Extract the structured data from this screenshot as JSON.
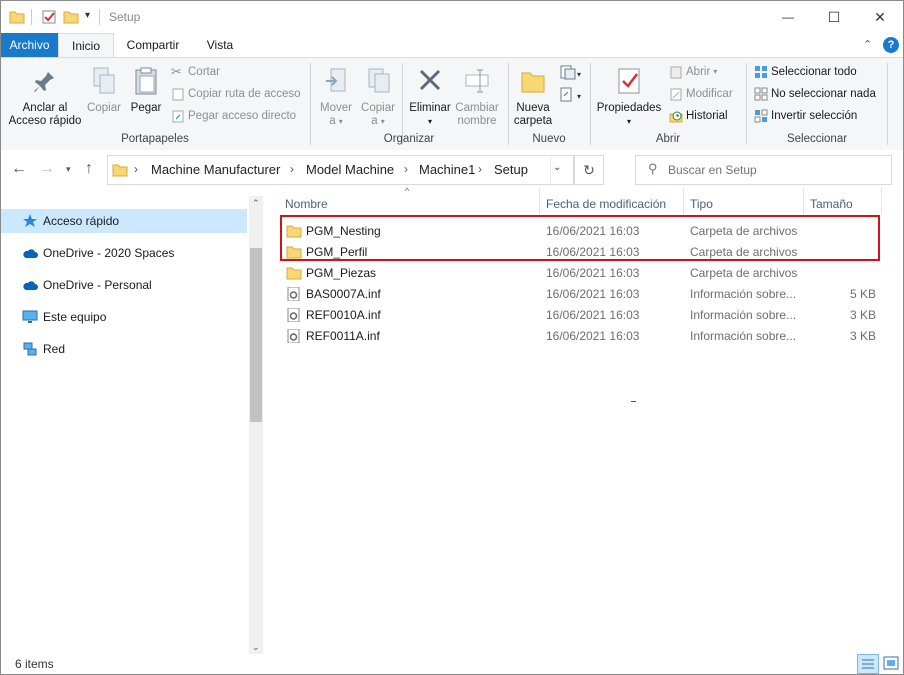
{
  "window": {
    "title": "Setup",
    "controls": {
      "minimize": "—",
      "maximize": "☐",
      "close": "✕"
    }
  },
  "ribbon_tabs": [
    {
      "label": "Archivo"
    },
    {
      "label": "Inicio"
    },
    {
      "label": "Compartir"
    },
    {
      "label": "Vista"
    }
  ],
  "ribbon": {
    "portapapeles": {
      "group_label": "Portapapeles",
      "pin_label_1": "Anclar al",
      "pin_label_2": "Acceso rápido",
      "copy_label": "Copiar",
      "paste_label": "Pegar",
      "cut_label": "Cortar",
      "copy_path_label": "Copiar ruta de acceso",
      "paste_shortcut_label": "Pegar acceso directo"
    },
    "organizar": {
      "group_label": "Organizar",
      "move_label_1": "Mover",
      "move_label_2": "a",
      "copyto_label_1": "Copiar",
      "copyto_label_2": "a",
      "delete_label": "Eliminar",
      "rename_label_1": "Cambiar",
      "rename_label_2": "nombre"
    },
    "nuevo": {
      "group_label": "Nuevo",
      "new_folder_label_1": "Nueva",
      "new_folder_label_2": "carpeta"
    },
    "abrir": {
      "group_label": "Abrir",
      "properties_label": "Propiedades",
      "open_label": "Abrir",
      "edit_label": "Modificar",
      "history_label": "Historial"
    },
    "seleccionar": {
      "group_label": "Seleccionar",
      "select_all_label": "Seleccionar todo",
      "select_none_label": "No seleccionar nada",
      "invert_label": "Invertir selección"
    }
  },
  "address": {
    "crumbs": [
      "Machine Manufacturer",
      "Model Machine",
      "Machine1",
      "Setup"
    ],
    "search_placeholder": "Buscar en Setup"
  },
  "nav_pane": {
    "items": [
      {
        "label": "Acceso rápido",
        "icon": "star-icon"
      },
      {
        "label": "OneDrive - 2020 Spaces",
        "icon": "cloud-icon"
      },
      {
        "label": "OneDrive - Personal",
        "icon": "cloud-icon"
      },
      {
        "label": "Este equipo",
        "icon": "computer-icon"
      },
      {
        "label": "Red",
        "icon": "network-icon"
      }
    ]
  },
  "columns": {
    "name": "Nombre",
    "date": "Fecha de modificación",
    "type": "Tipo",
    "size": "Tamaño"
  },
  "files": [
    {
      "name": "PGM_Nesting",
      "date": "16/06/2021 16:03",
      "type": "Carpeta de archivos",
      "size": "",
      "icon": "folder-icon"
    },
    {
      "name": "PGM_Perfil",
      "date": "16/06/2021 16:03",
      "type": "Carpeta de archivos",
      "size": "",
      "icon": "folder-icon"
    },
    {
      "name": "PGM_Piezas",
      "date": "16/06/2021 16:03",
      "type": "Carpeta de archivos",
      "size": "",
      "icon": "folder-icon"
    },
    {
      "name": "BAS0007A.inf",
      "date": "16/06/2021 16:03",
      "type": "Información sobre...",
      "size": "5 KB",
      "icon": "settings-file-icon"
    },
    {
      "name": "REF0010A.inf",
      "date": "16/06/2021 16:03",
      "type": "Información sobre...",
      "size": "3 KB",
      "icon": "settings-file-icon"
    },
    {
      "name": "REF0011A.inf",
      "date": "16/06/2021 16:03",
      "type": "Información sobre...",
      "size": "3 KB",
      "icon": "settings-file-icon"
    }
  ],
  "status": {
    "item_count": "6 items"
  },
  "colors": {
    "file_tab": "#1979ca",
    "selection": "#cce8ff",
    "highlight_border": "#d0121b",
    "folder": "#f8d775"
  }
}
